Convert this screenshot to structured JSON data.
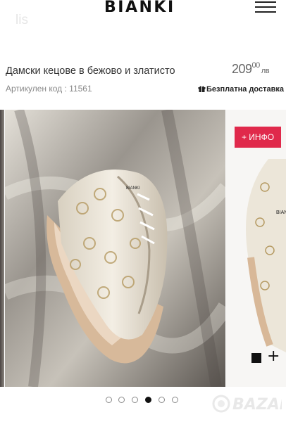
{
  "header": {
    "ghost_text": "lis",
    "logo": "BIANKI",
    "menu_icon": "hamburger-menu-icon"
  },
  "product": {
    "title": "Дамски кецове в бежово и златисто",
    "price_whole": "209",
    "price_cents": "00",
    "currency": "лв",
    "article": "Артикулен код : 11561",
    "delivery": "Безплатна доставка",
    "delivery_icon": "gift-icon"
  },
  "gallery": {
    "info_label": "+ ИНФО",
    "plus_label": "+",
    "swatch_color": "#111111",
    "dots_count": 6,
    "active_dot": 4,
    "slide_brand": "BIANKI"
  },
  "watermark": {
    "text": "BAZAR"
  },
  "colors": {
    "accent": "#e0294b",
    "text": "#333333"
  }
}
